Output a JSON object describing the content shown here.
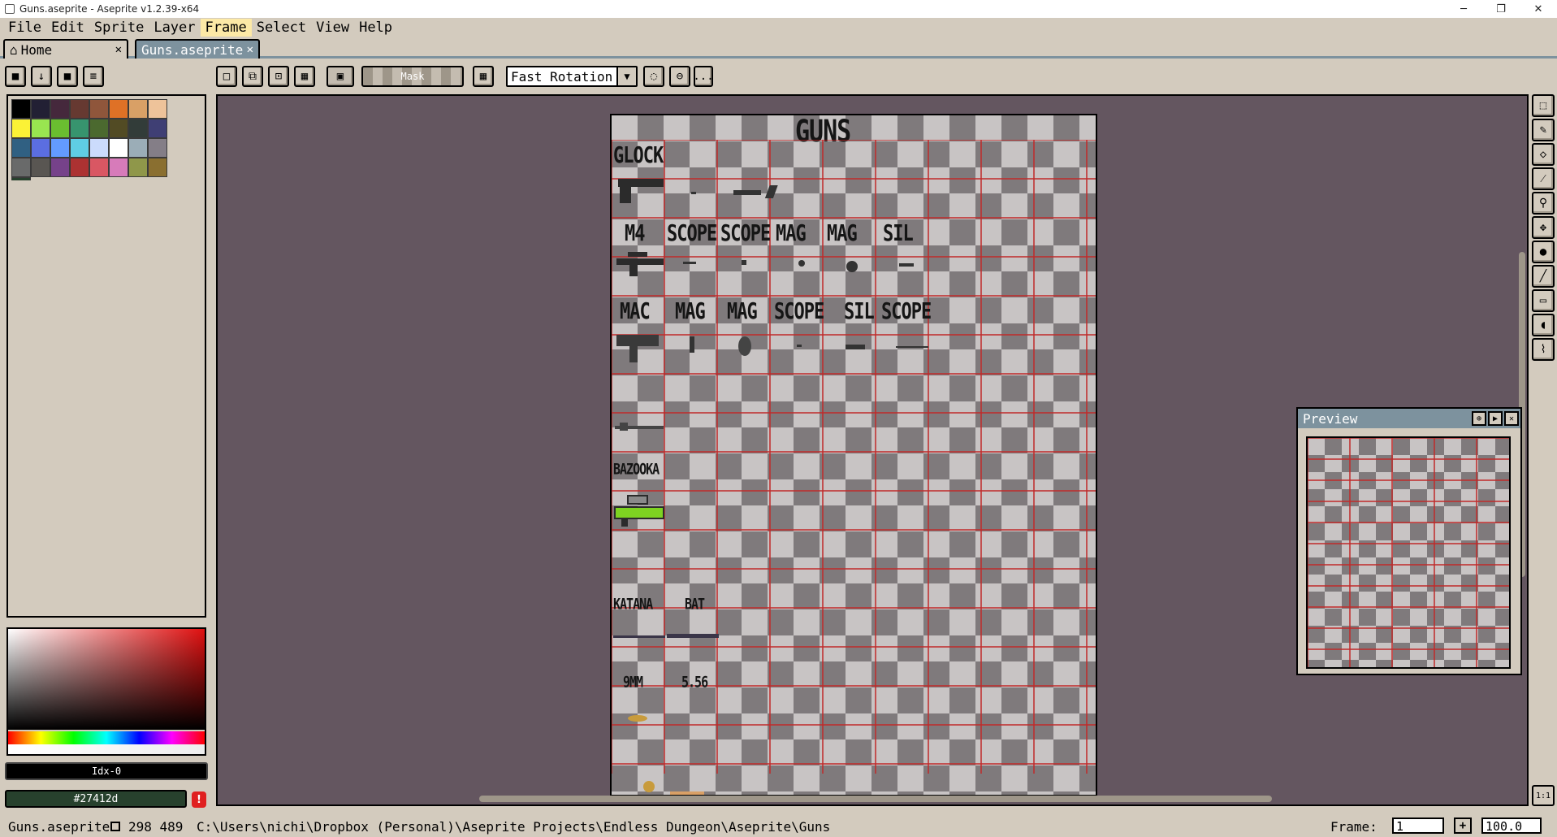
{
  "window": {
    "title": "Guns.aseprite - Aseprite v1.2.39-x64",
    "minimize": "─",
    "maximize": "❐",
    "close": "✕"
  },
  "menu": [
    "File",
    "Edit",
    "Sprite",
    "Layer",
    "Frame",
    "Select",
    "View",
    "Help"
  ],
  "tabs": {
    "home": "Home",
    "file": "Guns.aseprite",
    "close": "✕",
    "home_icon": "⌂"
  },
  "toolbar": {
    "mask_label": "Mask",
    "rotation_value": "Fast Rotation",
    "more": "..."
  },
  "palette": {
    "colors": [
      "#000000",
      "#222034",
      "#45283c",
      "#663931",
      "#8f563b",
      "#df7126",
      "#d9a066",
      "#eec39a",
      "#fbf236",
      "#99e550",
      "#6abe30",
      "#37946e",
      "#4b692f",
      "#524b24",
      "#323c39",
      "#3f3f74",
      "#306082",
      "#5b6ee1",
      "#639bff",
      "#5fcde4",
      "#cbdbfc",
      "#ffffff",
      "#9badb7",
      "#847e87",
      "#696a6a",
      "#595652",
      "#76428a",
      "#ac3232",
      "#d95763",
      "#d77bba",
      "#8f974a",
      "#8a6f30",
      "#27412d"
    ]
  },
  "color_bar": {
    "index": "Idx-0",
    "hex": "#27412d",
    "warning": "!"
  },
  "sprite": {
    "header": "GUNS",
    "labels": [
      {
        "text": "GLOCK",
        "size": "large"
      },
      {
        "text": "M4",
        "size": "large"
      },
      {
        "text": "SCOPE",
        "size": "large"
      },
      {
        "text": "SCOPE",
        "size": "large"
      },
      {
        "text": "MAG",
        "size": "large"
      },
      {
        "text": "MAG",
        "size": "large"
      },
      {
        "text": "SIL",
        "size": "large"
      },
      {
        "text": "MAC",
        "size": "large"
      },
      {
        "text": "MAG",
        "size": "large"
      },
      {
        "text": "MAG",
        "size": "large"
      },
      {
        "text": "SCOPE",
        "size": "large"
      },
      {
        "text": "SIL",
        "size": "large"
      },
      {
        "text": "SCOPE",
        "size": "large"
      },
      {
        "text": "BAZOOKA",
        "size": "small"
      },
      {
        "text": "KATANA",
        "size": "small"
      },
      {
        "text": "BAT",
        "size": "small"
      },
      {
        "text": "9MM",
        "size": "small"
      },
      {
        "text": "5.56",
        "size": "small"
      }
    ]
  },
  "preview": {
    "title": "Preview"
  },
  "status": {
    "file": "Guns.aseprite",
    "size": "298 489",
    "path": "C:\\Users\\nichi\\Dropbox (Personal)\\Aseprite Projects\\Endless Dungeon\\Aseprite\\Guns",
    "frame_label": "Frame:",
    "frame_value": "1",
    "zoom_value": "100.0",
    "add": "+"
  },
  "zoom_fit": "1:1"
}
